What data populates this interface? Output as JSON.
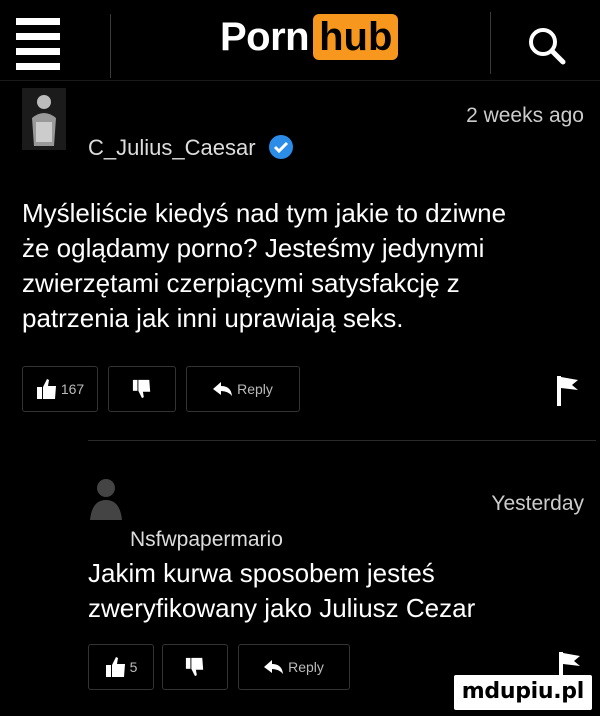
{
  "header": {
    "logo_porn": "Porn",
    "logo_hub": "hub",
    "menu_icon": "hamburger-menu-icon",
    "search_icon": "search-icon",
    "accent_color": "#f7971d"
  },
  "comments": [
    {
      "username": "C_Julius_Caesar",
      "verified": true,
      "timestamp": "2 weeks ago",
      "text_lines": [
        "Myśleliście kiedyś nad tym jakie to dziwne",
        "że oglądamy porno? Jesteśmy jedynymi",
        "zwierzętami czerpiącymi satysfakcję z",
        "patrzenia jak inni uprawiają seks."
      ],
      "likes": "167",
      "reply_label": "Reply"
    },
    {
      "username": "Nsfwpapermario",
      "verified": false,
      "timestamp": "Yesterday",
      "text_lines": [
        "Jakim kurwa sposobem jesteś",
        "zweryfikowany jako Juliusz Cezar"
      ],
      "likes": "5",
      "reply_label": "Reply"
    }
  ],
  "watermark": "mdupiu.pl"
}
